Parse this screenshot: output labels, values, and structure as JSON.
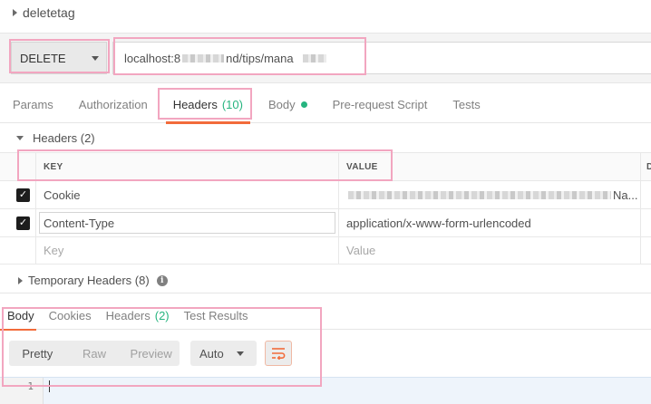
{
  "request": {
    "name": "deletetag",
    "method": "DELETE",
    "url_prefix": "localhost:8",
    "url_middle": "nd/tips/mana"
  },
  "request_tabs": [
    {
      "label": "Params"
    },
    {
      "label": "Authorization"
    },
    {
      "label": "Headers",
      "count": "(10)"
    },
    {
      "label": "Body"
    },
    {
      "label": "Pre-request Script"
    },
    {
      "label": "Tests"
    }
  ],
  "headers_section": {
    "title": "Headers (2)",
    "columns": {
      "key": "KEY",
      "value": "VALUE",
      "description": "D"
    },
    "rows": [
      {
        "key": "Cookie",
        "value_suffix": "Na..."
      },
      {
        "key": "Content-Type",
        "value": "application/x-www-form-urlencoded"
      }
    ],
    "new_row": {
      "key_placeholder": "Key",
      "value_placeholder": "Value"
    }
  },
  "temporary_headers": {
    "title": "Temporary Headers (8)"
  },
  "response_tabs": [
    {
      "label": "Body"
    },
    {
      "label": "Cookies"
    },
    {
      "label": "Headers",
      "count": "(2)"
    },
    {
      "label": "Test Results"
    }
  ],
  "response_toolbar": {
    "views": [
      "Pretty",
      "Raw",
      "Preview"
    ],
    "format": "Auto"
  },
  "editor": {
    "line_number": "1"
  },
  "colors": {
    "accent": "#f26b3a",
    "count_green": "#26b47f",
    "highlight": "#f2a6c0"
  }
}
